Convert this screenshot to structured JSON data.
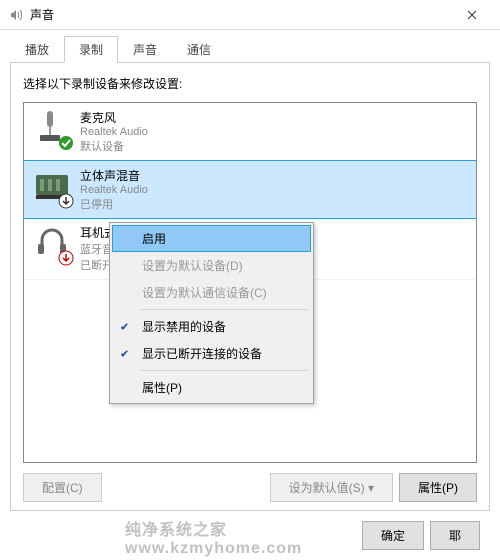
{
  "title": "声音",
  "tabs": [
    {
      "label": "播放"
    },
    {
      "label": "录制",
      "active": true
    },
    {
      "label": "声音"
    },
    {
      "label": "通信"
    }
  ],
  "instruction": "选择以下录制设备来修改设置:",
  "devices": [
    {
      "name": "麦克风",
      "vendor": "Realtek Audio",
      "status": "默认设备",
      "icon": "microphone",
      "overlay": "default-check",
      "selected": false
    },
    {
      "name": "立体声混音",
      "vendor": "Realtek Audio",
      "status": "已停用",
      "icon": "mixer",
      "overlay": "disabled-down",
      "selected": true
    },
    {
      "name": "耳机式",
      "vendor": "蓝牙音",
      "status": "已断开",
      "icon": "headset",
      "overlay": "disconnect-red",
      "selected": false
    }
  ],
  "context_menu": {
    "items": [
      {
        "label": "启用",
        "type": "item",
        "highlighted": true
      },
      {
        "label": "设置为默认设备(D)",
        "type": "item",
        "disabled": true
      },
      {
        "label": "设置为默认通信设备(C)",
        "type": "item",
        "disabled": true
      },
      {
        "type": "separator"
      },
      {
        "label": "显示禁用的设备",
        "type": "check",
        "checked": true
      },
      {
        "label": "显示已断开连接的设备",
        "type": "check",
        "checked": true
      },
      {
        "type": "separator"
      },
      {
        "label": "属性(P)",
        "type": "item"
      }
    ]
  },
  "panel_buttons": {
    "configure": "配置(C)",
    "set_default": "设为默认值(S)",
    "properties": "属性(P)"
  },
  "bottom_buttons": {
    "ok": "确定",
    "cancel": "耶"
  },
  "watermark": "纯净系统之家 www.kzmyhome.com"
}
